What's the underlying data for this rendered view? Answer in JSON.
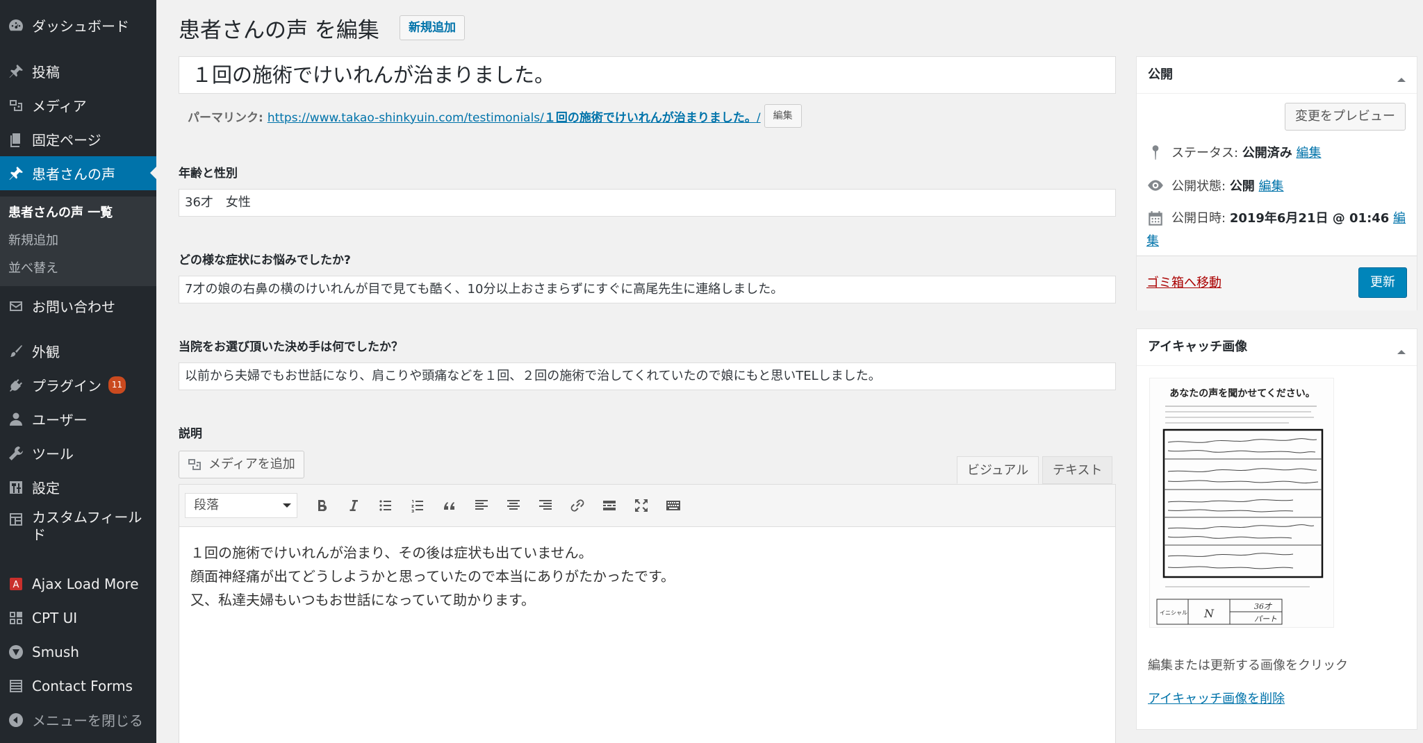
{
  "sidebar": {
    "items": [
      {
        "label": "ダッシュボード",
        "icon": "dashboard-icon"
      },
      {
        "label": "投稿",
        "icon": "pin-icon"
      },
      {
        "label": "メディア",
        "icon": "media-icon"
      },
      {
        "label": "固定ページ",
        "icon": "page-icon"
      },
      {
        "label": "患者さんの声",
        "icon": "pin-icon"
      },
      {
        "label": "お問い合わせ",
        "icon": "mail-icon"
      },
      {
        "label": "外観",
        "icon": "brush-icon"
      },
      {
        "label": "プラグイン",
        "icon": "plugin-icon",
        "badge": "11"
      },
      {
        "label": "ユーザー",
        "icon": "user-icon"
      },
      {
        "label": "ツール",
        "icon": "wrench-icon"
      },
      {
        "label": "設定",
        "icon": "settings-icon"
      },
      {
        "label": "カスタムフィールド",
        "icon": "custom-fields-icon"
      },
      {
        "label": "Ajax Load More",
        "icon": "ajax-load-more-icon"
      },
      {
        "label": "CPT UI",
        "icon": "cpt-ui-icon"
      },
      {
        "label": "Smush",
        "icon": "smush-icon"
      },
      {
        "label": "Contact Forms",
        "icon": "contact-forms-icon"
      },
      {
        "label": "メニューを閉じる",
        "icon": "collapse-icon"
      }
    ],
    "submenu": [
      "患者さんの声 一覧",
      "新規追加",
      "並べ替え"
    ]
  },
  "header": {
    "title": "患者さんの声 を編集",
    "add_new": "新規追加"
  },
  "post": {
    "title": "１回の施術でけいれんが治まりました。",
    "permalink_label": "パーマリンク:",
    "permalink_base": "https://www.takao-shinkyuin.com/testimonials/",
    "permalink_slug": "１回の施術でけいれんが治まりました。",
    "permalink_suffix": "/",
    "permalink_edit": "編集"
  },
  "fields": [
    {
      "label": "年齢と性別",
      "value": "36才　女性"
    },
    {
      "label": "どの様な症状にお悩みでしたか?",
      "value": "7才の娘の右鼻の横のけいれんが目で見ても酷く、10分以上おさまらずにすぐに高尾先生に連絡しました。"
    },
    {
      "label": "当院をお選び頂いた決め手は何でしたか？",
      "value": "以前から夫婦でもお世話になり、肩こりや頭痛などを１回、２回の施術で治してくれていたので娘にもと思いTELしました。"
    },
    {
      "label": "説明"
    }
  ],
  "editor": {
    "add_media": "メディアを追加",
    "tab_visual": "ビジュアル",
    "tab_text": "テキスト",
    "format": "段落",
    "lines": [
      "１回の施術でけいれんが治まり、その後は症状も出ていません。",
      "顔面神経痛が出てどうしようかと思っていたので本当にありがたかったです。",
      "又、私達夫婦もいつもお世話になっていて助かります。"
    ]
  },
  "publish": {
    "title": "公開",
    "preview": "変更をプレビュー",
    "status_label": "ステータス:",
    "status_value": "公開済み",
    "visibility_label": "公開状態:",
    "visibility_value": "公開",
    "date_label": "公開日時:",
    "date_value": "2019年6月21日 @ 01:46",
    "edit": "編集",
    "edit_head": "編",
    "edit_tail": "集",
    "trash": "ゴミ箱へ移動",
    "update": "更新"
  },
  "thumbnail": {
    "title": "アイキャッチ画像",
    "caption": "編集または更新する画像をクリック",
    "remove": "アイキャッチ画像を削除",
    "image_heading": "あなたの声を聞かせてください。",
    "image_initial_label": "イニシャル",
    "image_initial_value": "N",
    "image_age_value": "36才",
    "image_job_value": "パート"
  },
  "colors": {
    "sidebar_bg": "#23282d",
    "accent": "#0073aa",
    "update_button": "#0085ba",
    "trash": "#aa0000",
    "badge": "#ca4a1f"
  }
}
